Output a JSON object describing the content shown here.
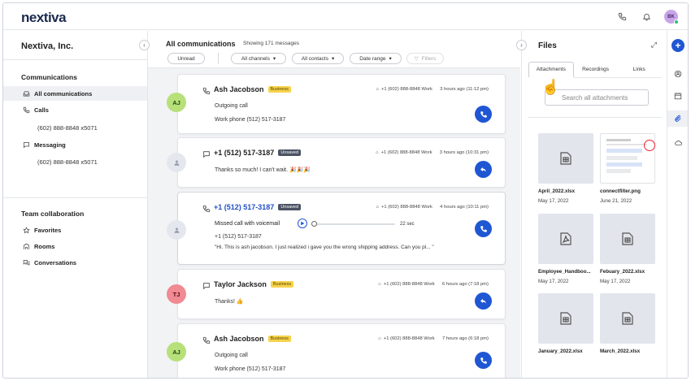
{
  "app": {
    "logo": "nextiva",
    "user_initials": "BK"
  },
  "sidebar": {
    "org_name": "Nextiva, Inc.",
    "communications_title": "Communications",
    "items": [
      {
        "label": "All communications",
        "icon": "inbox-icon"
      },
      {
        "label": "Calls",
        "icon": "phone-icon"
      },
      {
        "label": "(602) 888-8848 x5071"
      },
      {
        "label": "Messaging",
        "icon": "chat-icon"
      },
      {
        "label": "(602) 888-8848 x5071"
      }
    ],
    "team_title": "Team collaboration",
    "team_items": [
      {
        "label": "Favorites",
        "icon": "star-icon"
      },
      {
        "label": "Rooms",
        "icon": "building-icon"
      },
      {
        "label": "Conversations",
        "icon": "conversations-icon"
      }
    ]
  },
  "main": {
    "title": "All communications",
    "count": "Showing 171 messages",
    "filters": {
      "unread": "Unread",
      "channels": "All channels",
      "contacts": "All contacts",
      "date": "Date range",
      "more": "Filters"
    },
    "cards": [
      {
        "initials": "AJ",
        "name": "Ash Jacobson",
        "badge": "Business",
        "meta": "+1 (602) 888-8848 Work",
        "time": "3 hours ago (11:12 pm)",
        "line1": "Outgoing call",
        "line2": "Work phone (512) 517-3187"
      },
      {
        "name": "+1 (512) 517-3187",
        "badge": "Unsaved",
        "meta": "+1 (602) 888-8848 Work",
        "time": "3 hours ago (10:31 pm)",
        "line1": "Thanks so much! I can't wait. 🎉🎉🎉"
      },
      {
        "name": "+1 (512) 517-3187",
        "badge": "Unsaved",
        "meta": "+1 (602) 888-8848 Work",
        "time": "4 hours ago (10:11 pm)",
        "line1": "Missed call with voicemail",
        "duration": "22 sec",
        "line2": "+1 (512) 517-3187",
        "line3": "\"Hi. This is ash jacobson. I just realized i gave you the wrong shipping address. Can you pl... \""
      },
      {
        "initials": "TJ",
        "name": "Taylor Jackson",
        "badge": "Business",
        "meta": "+1 (602) 888-8848 Work",
        "time": "6 hours ago (7:18 pm)",
        "line1": "Thanks! 👍"
      },
      {
        "initials": "AJ",
        "name": "Ash Jacobson",
        "badge": "Business",
        "meta": "+1 (602) 888-8848 Work",
        "time": "7 hours ago (6:18 pm)",
        "line1": "Outgoing call",
        "line2": "Work phone (512) 517-3187"
      }
    ]
  },
  "files": {
    "title": "Files",
    "tabs": [
      "Attachments",
      "Recordings",
      "Links"
    ],
    "search_placeholder": "Search all attachments",
    "items": [
      {
        "name": "April_2022.xlsx",
        "date": "May 17, 2022",
        "icon": "spreadsheet-icon"
      },
      {
        "name": "connectfilter.png",
        "date": "June 21, 2022",
        "icon": "image-preview"
      },
      {
        "name": "Employee_Handboo...",
        "date": "May 17, 2022",
        "icon": "pdf-icon"
      },
      {
        "name": "Febuary_2022.xlsx",
        "date": "May 17, 2022",
        "icon": "spreadsheet-icon"
      },
      {
        "name": "January_2022.xlsx",
        "date": "",
        "icon": "spreadsheet-icon"
      },
      {
        "name": "March_2022.xlsx",
        "date": "",
        "icon": "spreadsheet-icon"
      }
    ]
  },
  "colors": {
    "accent": "#1f56d4",
    "biz_badge": "#f6d34b",
    "unsaved_badge": "#4a5363",
    "aj_avatar": "#b7e07a",
    "tj_avatar": "#f08a93"
  }
}
